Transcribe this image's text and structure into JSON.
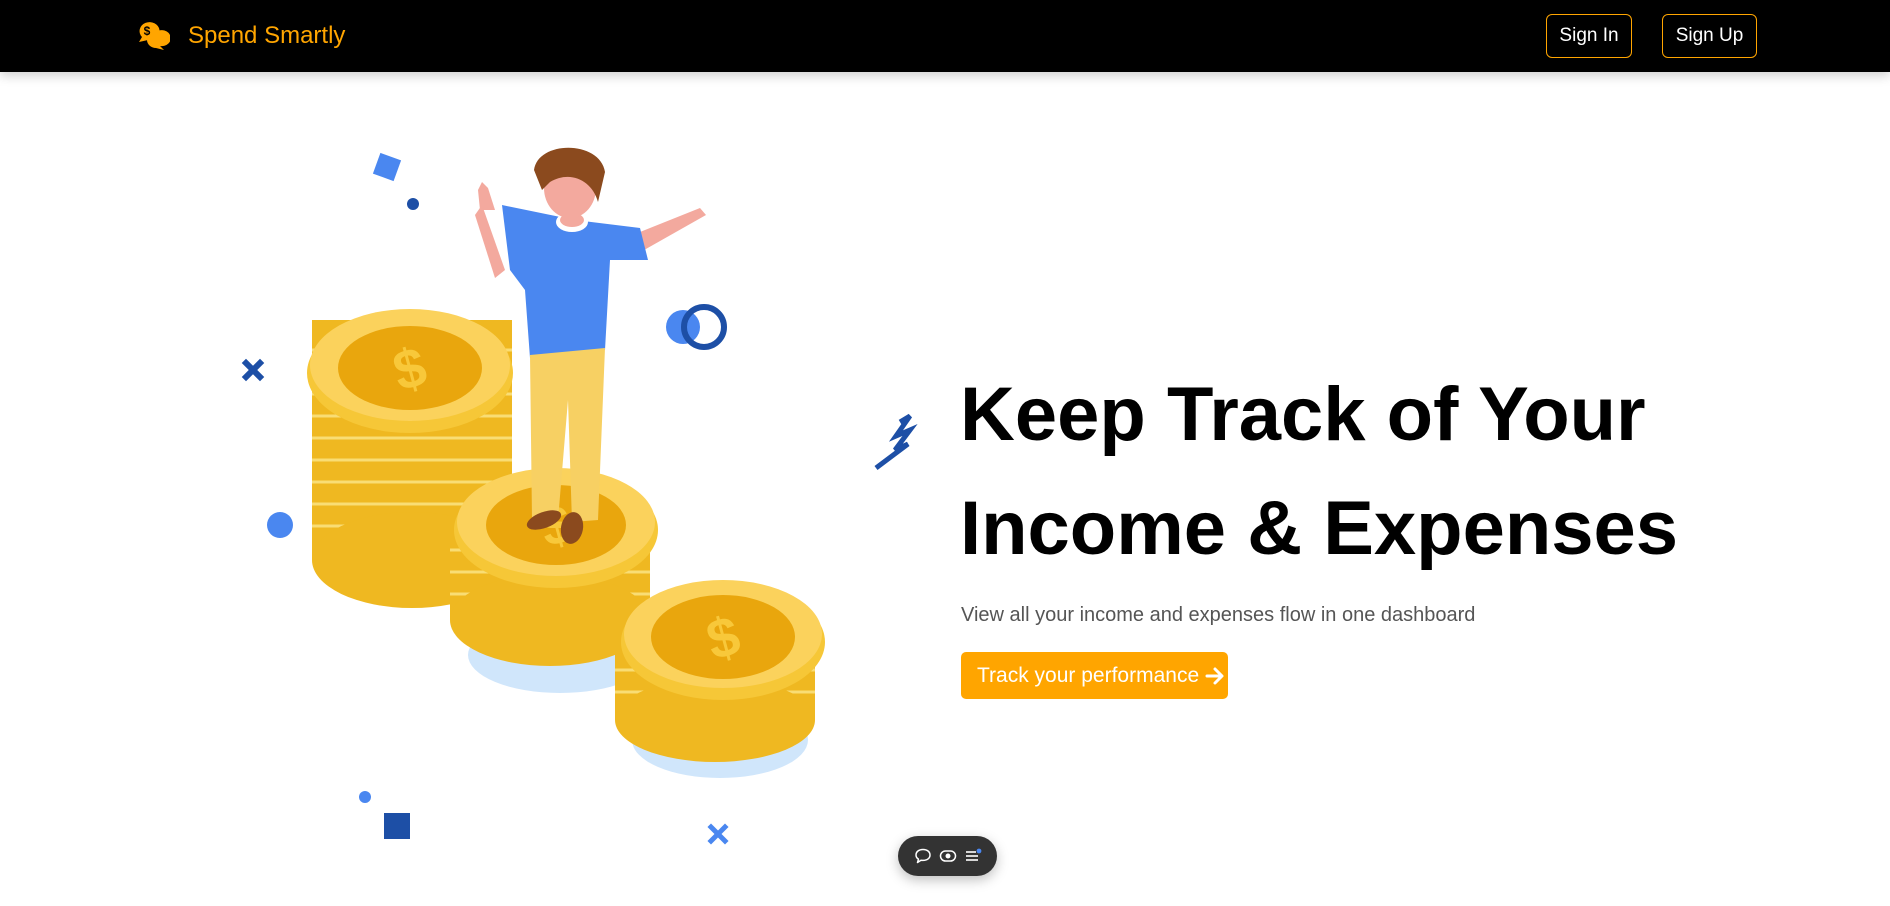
{
  "navbar": {
    "brand": "Spend Smartly",
    "sign_in": "Sign In",
    "sign_up": "Sign Up"
  },
  "hero": {
    "title_line1": "Keep Track of Your",
    "title_line2": "Income & Expenses",
    "subtitle": "View all your income and expenses flow in one dashboard",
    "cta": "Track your performance"
  },
  "icons": {
    "brand": "chat-coins-icon",
    "cta": "arrow-right-icon",
    "toolbar": [
      "comment-icon",
      "eye-icon",
      "list-icon"
    ]
  },
  "colors": {
    "navbar_bg": "#000000",
    "accent": "#ffa500",
    "title": "#000000",
    "subtitle": "#555555",
    "coin": "#f7c325",
    "person_shirt": "#4a87f0",
    "person_pants": "#f7d063",
    "confetti_dark": "#1d4fa6",
    "confetti_light": "#4a87f0",
    "shadow": "#d0e6fb",
    "toolbar_bg": "#333333"
  }
}
